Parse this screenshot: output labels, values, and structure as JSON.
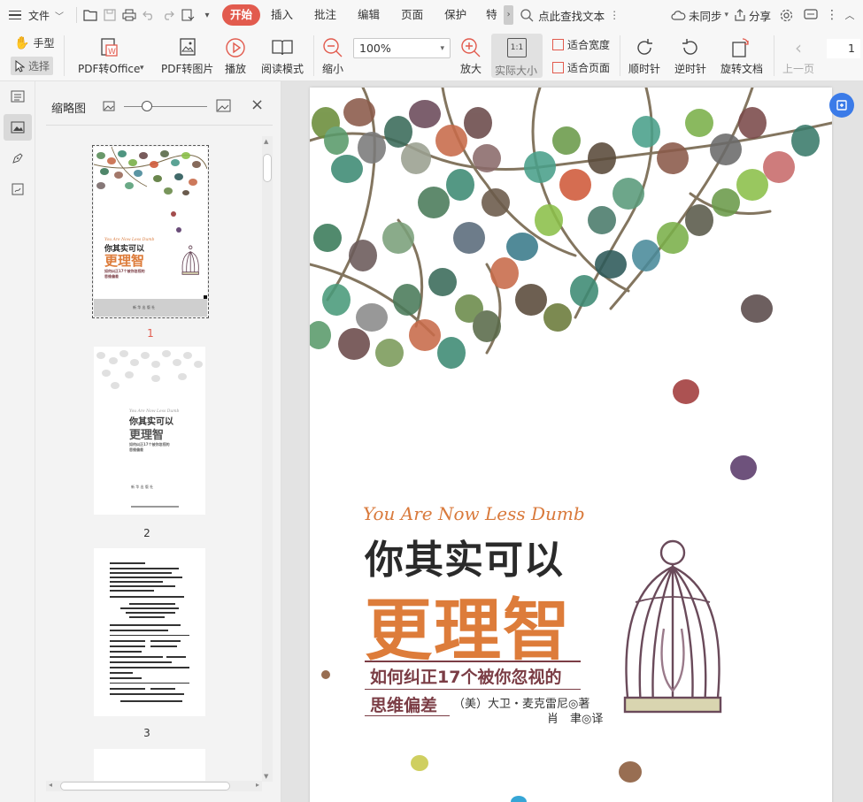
{
  "menubar": {
    "file_label": "文件",
    "tabs": [
      {
        "label": "开始",
        "active": true
      },
      {
        "label": "插入"
      },
      {
        "label": "批注"
      },
      {
        "label": "编辑"
      },
      {
        "label": "页面"
      },
      {
        "label": "保护"
      },
      {
        "label": "特色"
      }
    ],
    "search_placeholder": "点此查找文本",
    "sync_label": "未同步",
    "share_label": "分享"
  },
  "ribbon": {
    "hand_label": "手型",
    "select_label": "选择",
    "pdf_to_office": "PDF转Office",
    "pdf_to_image": "PDF转图片",
    "play": "播放",
    "read_mode": "阅读模式",
    "zoom_out": "缩小",
    "zoom_value": "100%",
    "zoom_in": "放大",
    "actual_size": "实际大小",
    "actual_icon_text": "1:1",
    "fit_width": "适合宽度",
    "fit_page": "适合页面",
    "rotate_cw": "顺时针",
    "rotate_ccw": "逆时针",
    "rotate_doc": "旋转文档",
    "prev_page": "上一页",
    "page_number": "1"
  },
  "thumbnails": {
    "title": "缩略图",
    "pages": [
      {
        "number": "1",
        "selected": true
      },
      {
        "number": "2"
      },
      {
        "number": "3"
      }
    ],
    "thumb1": {
      "sub": "You Are Now Less Dumb",
      "title1": "你其实可以",
      "title2": "更理智",
      "line1": "如何纠正17个被你忽视的",
      "line2": "思维偏差",
      "footer": "新 华 出 版 社"
    },
    "thumb2": {
      "sub": "You Are Now Less Dumb",
      "title1": "你其实可以",
      "title2": "更理智",
      "line1": "如何纠正17个被你忽视的",
      "line2": "思维偏差",
      "footer": "新 华 出 版 社"
    }
  },
  "cover": {
    "subtitle_en": "You Are Now Less Dumb",
    "title_line1": "你其实可以",
    "title_line2": "更理智",
    "subtitle_line1": "如何纠正17个被你忽视的",
    "subtitle_line2": "思维偏差",
    "author": "（美）大卫・麦克雷尼◎著",
    "translator": "肖　聿◎译"
  },
  "colors": {
    "accent": "#e25b4e",
    "title_orange": "#dd7c3a",
    "subtitle_maroon": "#7b3d45",
    "blue_badge": "#3b7be8"
  }
}
